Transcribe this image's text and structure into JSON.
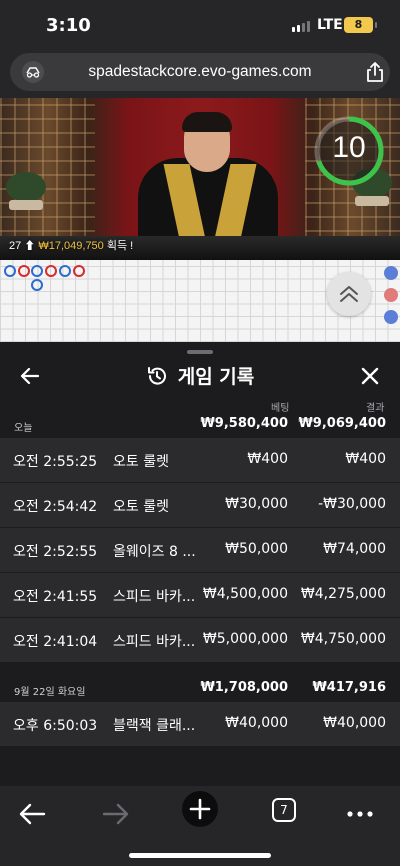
{
  "status_bar": {
    "time": "3:10",
    "network": "LTE",
    "battery": "8"
  },
  "browser": {
    "url": "spadestackcore.evo-games.com",
    "tab_count": "7"
  },
  "video": {
    "timer": "10",
    "balance_prefix": "27 ⬆",
    "balance_amount": "₩17,049,750",
    "balance_suffix": "획득 !"
  },
  "history": {
    "title": "게임 기록",
    "columns": {
      "bet": "베팅",
      "result": "결과"
    },
    "days": [
      {
        "label": "오늘",
        "total_bet": "₩9,580,400",
        "total_result": "₩9,069,400",
        "rows": [
          {
            "time": "오전 2:55:25",
            "game": "오토 룰렛",
            "bet": "₩400",
            "result": "₩400"
          },
          {
            "time": "오전 2:54:42",
            "game": "오토 룰렛",
            "bet": "₩30,000",
            "result": "-₩30,000"
          },
          {
            "time": "오전 2:52:55",
            "game": "올웨이즈 8 ...",
            "bet": "₩50,000",
            "result": "₩74,000"
          },
          {
            "time": "오전 2:41:55",
            "game": "스피드 바카...",
            "bet": "₩4,500,000",
            "result": "₩4,275,000"
          },
          {
            "time": "오전 2:41:04",
            "game": "스피드 바카...",
            "bet": "₩5,000,000",
            "result": "₩4,750,000"
          }
        ]
      },
      {
        "label": "9월 22일 화요일",
        "total_bet": "₩1,708,000",
        "total_result": "₩417,916",
        "rows": [
          {
            "time": "오후 6:50:03",
            "game": "블랙잭 클래...",
            "bet": "₩40,000",
            "result": "₩40,000"
          }
        ]
      }
    ]
  },
  "colors": {
    "player": "#2c6cd1",
    "banker": "#d62c2c",
    "timer_ring": "#3ec34a"
  },
  "icons": [
    "reader-icon",
    "share-icon",
    "history-icon",
    "back-arrow-icon",
    "close-icon",
    "chevron-up-icon",
    "plus-icon",
    "more-icon"
  ]
}
